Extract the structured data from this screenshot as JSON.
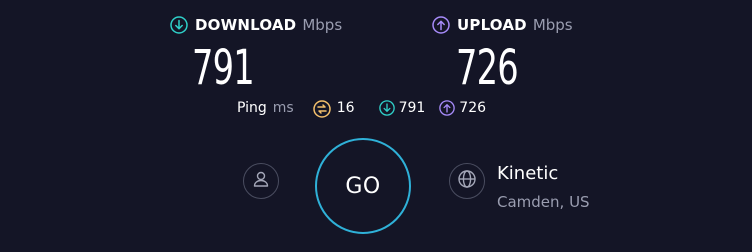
{
  "download": {
    "label": "DOWNLOAD",
    "unit": "Mbps",
    "value": "791",
    "icon": "arrow-down-circle-icon",
    "color": "#2fd0c9"
  },
  "upload": {
    "label": "UPLOAD",
    "unit": "Mbps",
    "value": "726",
    "icon": "arrow-up-circle-icon",
    "color": "#a78bfa"
  },
  "ping": {
    "label": "Ping",
    "unit": "ms",
    "idle": "16",
    "download": "791",
    "upload": "726",
    "idle_color": "#f5c16c"
  },
  "go_button": {
    "label": "GO",
    "color": "#2fb1d8"
  },
  "server": {
    "name": "Kinetic",
    "location": "Camden, US",
    "icon": "globe-icon"
  },
  "account": {
    "icon": "user-icon"
  }
}
